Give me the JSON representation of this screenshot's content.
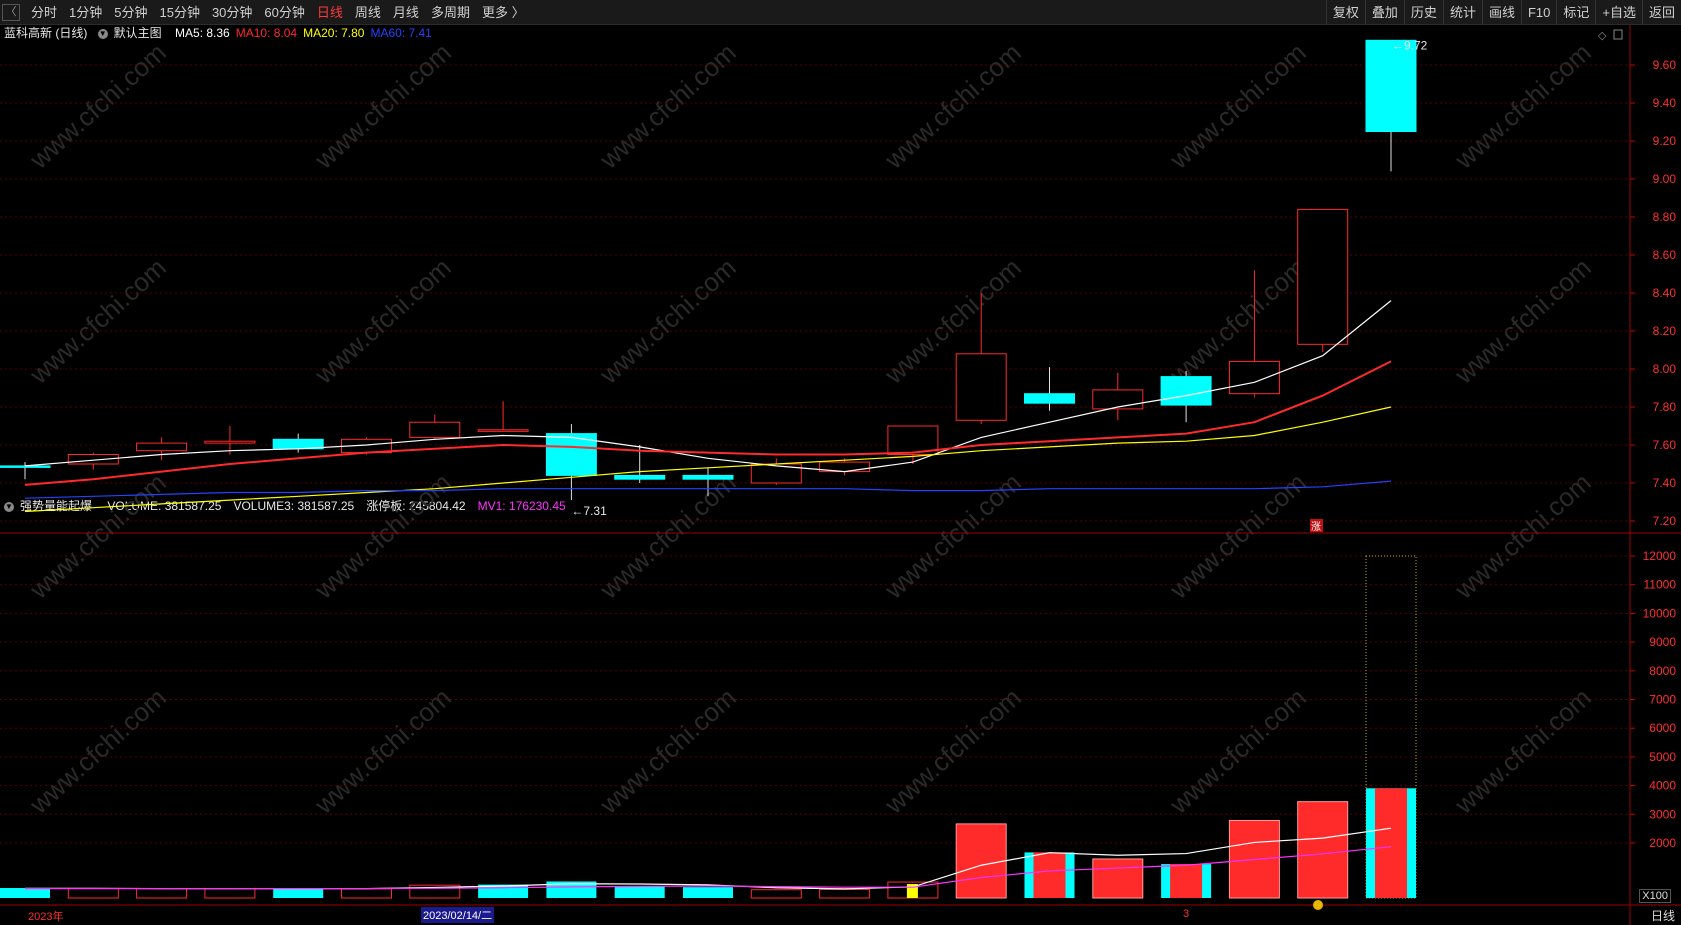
{
  "toolbar": {
    "collapse_glyph": "〈",
    "periods": [
      "分时",
      "1分钟",
      "5分钟",
      "15分钟",
      "30分钟",
      "60分钟",
      "日线",
      "周线",
      "月线",
      "多周期",
      "更多 〉"
    ],
    "active_period": "日线",
    "right_buttons": [
      "复权",
      "叠加",
      "历史",
      "统计",
      "画线",
      "F10",
      "标记",
      "+自选",
      "返回"
    ]
  },
  "main_panel": {
    "stock_name": "蓝科高新 (日线)",
    "template_label": "默认主图",
    "indicators": [
      {
        "label": "MA5: 8.36",
        "color": "#ffffff"
      },
      {
        "label": "MA10: 8.04",
        "color": "#ff2a2a"
      },
      {
        "label": "MA20: 7.80",
        "color": "#ffff00"
      },
      {
        "label": "MA60: 7.41",
        "color": "#2244ff"
      }
    ],
    "price_axis_ticks": [
      "9.60",
      "9.40",
      "9.20",
      "9.00",
      "8.80",
      "8.60",
      "8.40",
      "8.20",
      "8.00",
      "7.80",
      "7.60",
      "7.40",
      "7.20"
    ],
    "high_marker": "9.72",
    "low_marker": "7.31",
    "limit_up_tag": "涨"
  },
  "volume_panel": {
    "indicator_name": "强势量能起爆",
    "values": [
      {
        "label": "VOLUME: 381587.25",
        "color": "#e8e8e8"
      },
      {
        "label": "VOLUME3: 381587.25",
        "color": "#e8e8e8"
      },
      {
        "label": "涨停板: 245804.42",
        "color": "#e8e8e8"
      },
      {
        "label": "MV1: 176230.45",
        "color": "#ff33ff"
      }
    ],
    "axis_ticks": [
      "12000",
      "11000",
      "10000",
      "9000",
      "8000",
      "7000",
      "6000",
      "5000",
      "4000",
      "3000",
      "2000"
    ],
    "unit": "X100"
  },
  "bottom_axis": {
    "year_label": "2023年",
    "cursor_date": "2023/02/14/二",
    "month_label": "3",
    "period_label": "日线"
  },
  "watermark": "www.cfchi.com",
  "colors": {
    "up": "#ff2a2a",
    "down": "#00ffff",
    "grid": "#5a0000",
    "axis": "#cc0000"
  },
  "chart_data": [
    {
      "type": "candlestick",
      "title": "蓝科高新 (日线)",
      "ylim": [
        7.15,
        9.8
      ],
      "candles": [
        {
          "o": 7.49,
          "h": 7.51,
          "l": 7.42,
          "c": 7.49,
          "dir": "down"
        },
        {
          "o": 7.5,
          "h": 7.56,
          "l": 7.47,
          "c": 7.55,
          "dir": "up"
        },
        {
          "o": 7.57,
          "h": 7.64,
          "l": 7.52,
          "c": 7.61,
          "dir": "up"
        },
        {
          "o": 7.61,
          "h": 7.7,
          "l": 7.55,
          "c": 7.62,
          "dir": "up"
        },
        {
          "o": 7.63,
          "h": 7.66,
          "l": 7.56,
          "c": 7.58,
          "dir": "down"
        },
        {
          "o": 7.56,
          "h": 7.64,
          "l": 7.55,
          "c": 7.63,
          "dir": "up"
        },
        {
          "o": 7.64,
          "h": 7.76,
          "l": 7.63,
          "c": 7.72,
          "dir": "up"
        },
        {
          "o": 7.68,
          "h": 7.83,
          "l": 7.67,
          "c": 7.68,
          "dir": "up"
        },
        {
          "o": 7.66,
          "h": 7.71,
          "l": 7.31,
          "c": 7.44,
          "dir": "down"
        },
        {
          "o": 7.44,
          "h": 7.6,
          "l": 7.4,
          "c": 7.42,
          "dir": "down"
        },
        {
          "o": 7.44,
          "h": 7.48,
          "l": 7.33,
          "c": 7.42,
          "dir": "down"
        },
        {
          "o": 7.4,
          "h": 7.53,
          "l": 7.39,
          "c": 7.5,
          "dir": "up"
        },
        {
          "o": 7.46,
          "h": 7.53,
          "l": 7.44,
          "c": 7.51,
          "dir": "up"
        },
        {
          "o": 7.55,
          "h": 7.7,
          "l": 7.5,
          "c": 7.7,
          "dir": "up"
        },
        {
          "o": 7.73,
          "h": 8.4,
          "l": 7.71,
          "c": 8.08,
          "dir": "up"
        },
        {
          "o": 7.87,
          "h": 8.01,
          "l": 7.78,
          "c": 7.82,
          "dir": "down"
        },
        {
          "o": 7.79,
          "h": 7.98,
          "l": 7.73,
          "c": 7.89,
          "dir": "up"
        },
        {
          "o": 7.96,
          "h": 7.99,
          "l": 7.72,
          "c": 7.81,
          "dir": "down"
        },
        {
          "o": 7.87,
          "h": 8.52,
          "l": 7.85,
          "c": 8.04,
          "dir": "up"
        },
        {
          "o": 8.13,
          "h": 8.84,
          "l": 8.09,
          "c": 8.84,
          "dir": "up"
        },
        {
          "o": 9.73,
          "h": 9.73,
          "l": 9.04,
          "c": 9.25,
          "dir": "down"
        }
      ],
      "series": [
        {
          "name": "MA5",
          "color": "#ffffff",
          "values": [
            7.49,
            7.52,
            7.55,
            7.57,
            7.58,
            7.6,
            7.63,
            7.65,
            7.64,
            7.59,
            7.53,
            7.49,
            7.46,
            7.51,
            7.64,
            7.72,
            7.8,
            7.86,
            7.93,
            8.07,
            8.36
          ]
        },
        {
          "name": "MA10",
          "color": "#ff2a2a",
          "values": [
            7.39,
            7.42,
            7.46,
            7.5,
            7.53,
            7.56,
            7.58,
            7.6,
            7.59,
            7.57,
            7.56,
            7.55,
            7.55,
            7.56,
            7.6,
            7.62,
            7.64,
            7.66,
            7.72,
            7.86,
            8.04
          ]
        },
        {
          "name": "MA20",
          "color": "#ffff00",
          "values": [
            7.25,
            7.27,
            7.29,
            7.31,
            7.33,
            7.35,
            7.37,
            7.4,
            7.43,
            7.46,
            7.48,
            7.5,
            7.52,
            7.54,
            7.57,
            7.59,
            7.61,
            7.62,
            7.65,
            7.72,
            7.8
          ]
        },
        {
          "name": "MA60",
          "color": "#2244ff",
          "values": [
            7.32,
            7.33,
            7.34,
            7.35,
            7.35,
            7.36,
            7.36,
            7.37,
            7.37,
            7.37,
            7.37,
            7.37,
            7.37,
            7.36,
            7.36,
            7.37,
            7.37,
            7.37,
            7.37,
            7.38,
            7.41
          ]
        }
      ]
    },
    {
      "type": "bar",
      "title": "强势量能起爆",
      "ylabel": "X100",
      "ylim": [
        0,
        12400
      ],
      "volumes": [
        350,
        330,
        330,
        330,
        330,
        320,
        450,
        470,
        580,
        420,
        380,
        290,
        300,
        560,
        2600,
        1600,
        1370,
        1190,
        2720,
        3380,
        3850
      ],
      "colors": [
        "cyan",
        "red-outline",
        "red-outline",
        "red-outline",
        "cyan",
        "red-outline",
        "red-outline",
        "cyan",
        "cyan",
        "cyan",
        "cyan",
        "red-outline",
        "red-outline",
        "yellow",
        "red",
        "cyan",
        "red",
        "cyan",
        "red",
        "red",
        "cyan"
      ],
      "highlight": {
        "index": 20,
        "value": 12000
      },
      "series": [
        {
          "name": "VOLUME3",
          "color": "#ffffff",
          "values": [
            340,
            340,
            330,
            330,
            330,
            330,
            370,
            420,
            500,
            490,
            460,
            360,
            320,
            390,
            1150,
            1590,
            1500,
            1560,
            1950,
            2100,
            2450
          ]
        },
        {
          "name": "MV1",
          "color": "#ff33ff",
          "values": [
            330,
            330,
            330,
            330,
            330,
            330,
            340,
            360,
            390,
            410,
            420,
            400,
            380,
            380,
            720,
            950,
            1050,
            1150,
            1350,
            1550,
            1800
          ]
        }
      ]
    }
  ]
}
